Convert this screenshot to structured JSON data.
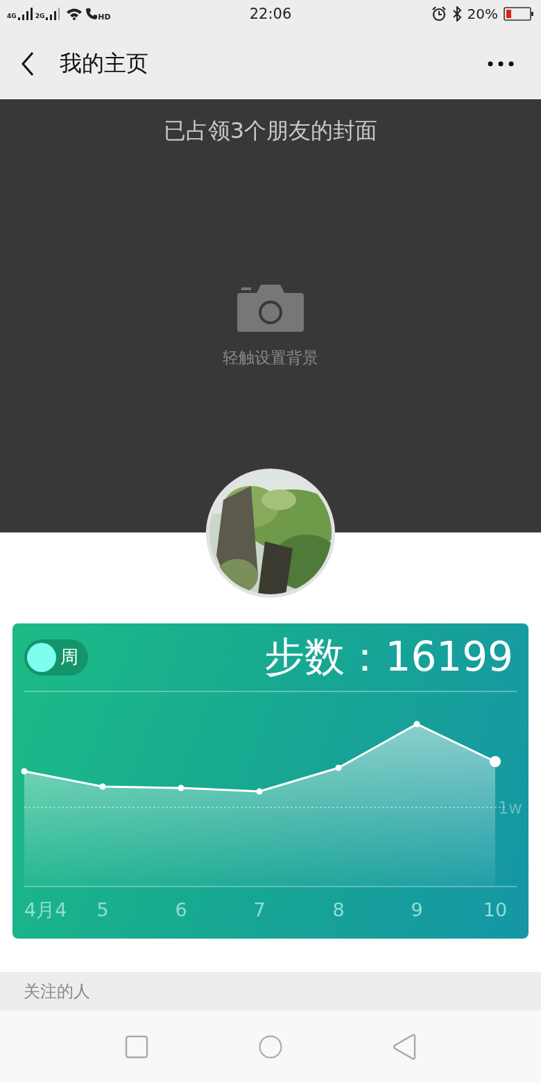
{
  "status_bar": {
    "network_1": "4G",
    "network_2": "2G",
    "call_badge": "HD",
    "time": "22:06",
    "battery": "20%"
  },
  "header": {
    "title": "我的主页"
  },
  "cover": {
    "notice": "已占领3个朋友的封面",
    "hint": "轻触设置背景"
  },
  "steps_card": {
    "period": "周",
    "steps": "步数：16199",
    "chart": {
      "x_labels": [
        "4月4",
        "5",
        "6",
        "7",
        "8",
        "9",
        "10"
      ],
      "reference_label": "1w"
    }
  },
  "following_section": {
    "title": "关注的人"
  }
}
